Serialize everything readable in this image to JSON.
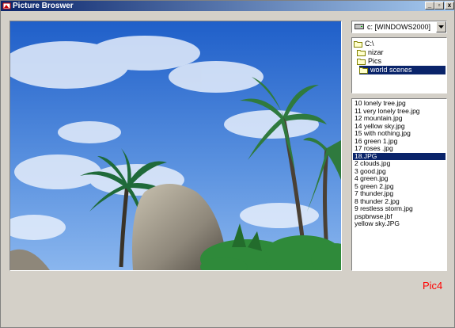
{
  "window": {
    "title": "Picture Broswer",
    "controls": {
      "min": "_",
      "max": "▫",
      "close": "x"
    }
  },
  "drive": {
    "value": "c: [WINDOWS2000]"
  },
  "directories": [
    {
      "label": "C:\\"
    },
    {
      "label": "nizar"
    },
    {
      "label": "Pics"
    },
    {
      "label": "world scenes",
      "selected": true
    }
  ],
  "files": [
    "10 lonely tree.jpg",
    "11 very lonely tree.jpg",
    "12 mountain.jpg",
    "14 yellow sky.jpg",
    "15 with nothing.jpg",
    "16 green 1.jpg",
    "17 roses .jpg",
    "18.JPG",
    "2 clouds.jpg",
    "3 good.jpg",
    "4 green.jpg",
    "5 green 2.jpg",
    "7 thunder.jpg",
    "8 thunder 2.jpg",
    "9 restless storm.jpg",
    "pspbrwse.jbf",
    "yellow sky.JPG"
  ],
  "selected_file": "18.JPG",
  "pic_label": "Pic4",
  "colors": {
    "titlebar_start": "#0a246a",
    "titlebar_end": "#a6caf0",
    "selection": "#0a246a",
    "label": "#ff0000"
  }
}
